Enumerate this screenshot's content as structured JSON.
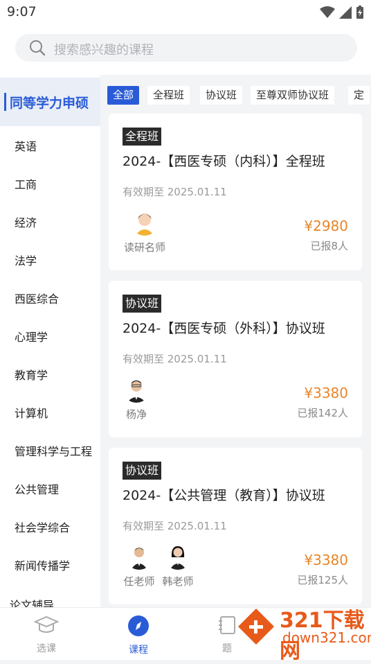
{
  "status": {
    "time": "9:07"
  },
  "search": {
    "placeholder": "搜索感兴趣的课程"
  },
  "sidebar": {
    "active": "同等学力申硕",
    "items": [
      "英语",
      "工商",
      "经济",
      "法学",
      "西医综合",
      "心理学",
      "教育学",
      "计算机",
      "管理科学与工程",
      "公共管理",
      "社会学综合",
      "新闻传播学",
      "论文辅导"
    ]
  },
  "tabs": [
    "全部",
    "全程班",
    "协议班",
    "至尊双师协议班",
    "定"
  ],
  "courses": [
    {
      "badge": "全程班",
      "title": "2024-【西医专硕（内科）】全程班",
      "validity": "有效期至 2025.01.11",
      "teachers": [
        "读研名师"
      ],
      "price": "¥2980",
      "enrolled": "已报8人"
    },
    {
      "badge": "协议班",
      "title": "2024-【西医专硕（外科）】协议班",
      "validity": "有效期至 2025.01.11",
      "teachers": [
        "杨净"
      ],
      "price": "¥3380",
      "enrolled": "已报142人"
    },
    {
      "badge": "协议班",
      "title": "2024-【公共管理（教育）】协议班",
      "validity": "有效期至 2025.01.11",
      "teachers": [
        "任老师",
        "韩老师"
      ],
      "price": "¥3380",
      "enrolled": "已报125人"
    }
  ],
  "bottom_nav": [
    "选课",
    "课程",
    "题"
  ],
  "watermark": {
    "brand": "321下载网",
    "domain": "down321.com"
  },
  "colors": {
    "accent": "#2a5bd7",
    "price": "#e8862a",
    "watermark": "#e85a1a"
  }
}
